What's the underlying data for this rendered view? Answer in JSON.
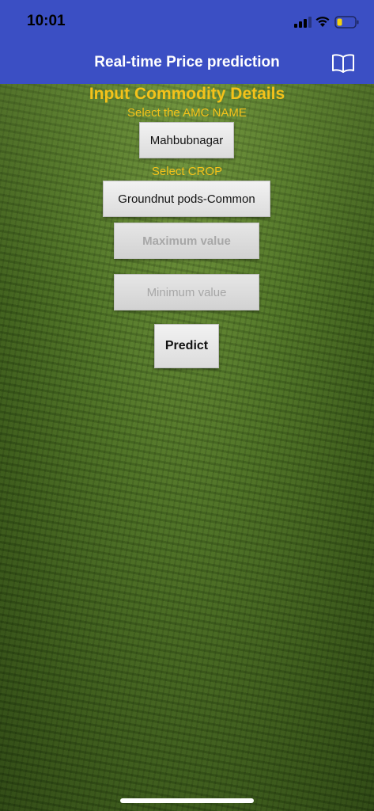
{
  "status_bar": {
    "time": "10:01"
  },
  "nav": {
    "title": "Real-time Price prediction",
    "icon": "book-icon"
  },
  "form": {
    "heading": "Input Commodity Details",
    "amc_label": "Select the AMC NAME",
    "amc_value": "Mahbubnagar",
    "crop_label": "Select CROP",
    "crop_value": "Groundnut pods-Common",
    "max_placeholder": "Maximum value",
    "min_placeholder": "Minimum value",
    "predict_label": "Predict"
  },
  "colors": {
    "nav_background": "#3b4fc4",
    "accent_text": "#f4c21a"
  }
}
